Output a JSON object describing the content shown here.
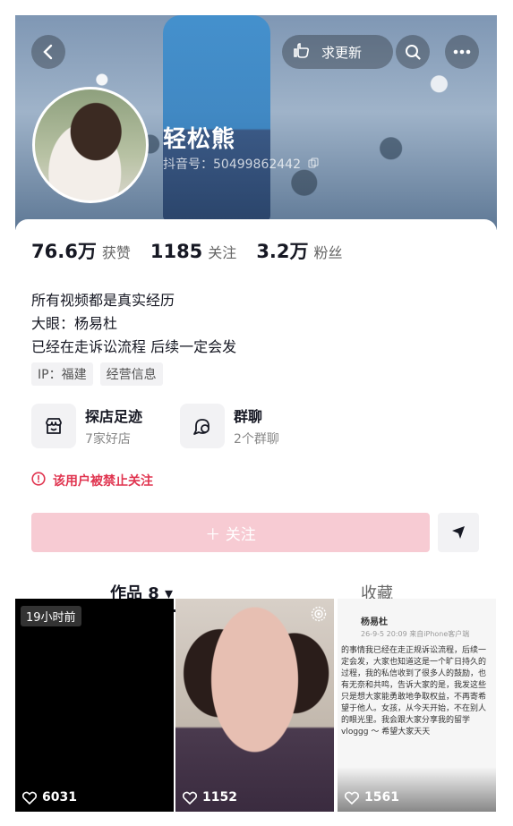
{
  "header": {
    "request_update_label": "求更新",
    "name": "轻松熊",
    "douyin_id": "抖音号：50499862442",
    "icons": [
      "back-icon",
      "hand-icon",
      "search-icon",
      "more-icon"
    ]
  },
  "stats": [
    {
      "value": "76.6万",
      "label": "获赞"
    },
    {
      "value": "1185",
      "label": "关注"
    },
    {
      "value": "3.2万",
      "label": "粉丝"
    }
  ],
  "bio": [
    "所有视频都是真实经历",
    "大眼：杨易杜",
    "已经在走诉讼流程 后续一定会发"
  ],
  "tags": [
    "IP：福建",
    "经营信息"
  ],
  "cards": [
    {
      "title": "探店足迹",
      "sub": "7家好店",
      "icon": "store-icon"
    },
    {
      "title": "群聊",
      "sub": "2个群聊",
      "icon": "chat-icon"
    }
  ],
  "warning": "该用户被禁止关注",
  "follow_label": "＋ 关注",
  "tabs": {
    "works": "作品 8 ▾",
    "favorites": "收藏"
  },
  "videos": [
    {
      "badge": "19小时前",
      "likes": "6031"
    },
    {
      "badge": "",
      "likes": "1152"
    },
    {
      "badge": "",
      "likes": "1561",
      "post_author": "杨易杜",
      "post_meta": "26-9-5 20:09 来自iPhone客户端",
      "post_text": "的事情我已经在走正规诉讼流程，后续一定会发，大家也知道这是一个旷日持久的过程，我的私信收到了很多人的鼓励，也有无奈和共鸣，告诉大家的是，我发这些只是想大家能勇敢地争取权益，不再寄希望于他人。女孩，从今天开始，不在别人的眼光里。我会跟大家分享我的留学 vloggg ～ 希望大家天天"
    }
  ],
  "colors": {
    "accent": "#fe2c55",
    "follow_disabled": "#f7cbd3",
    "warning": "#e0344f"
  }
}
